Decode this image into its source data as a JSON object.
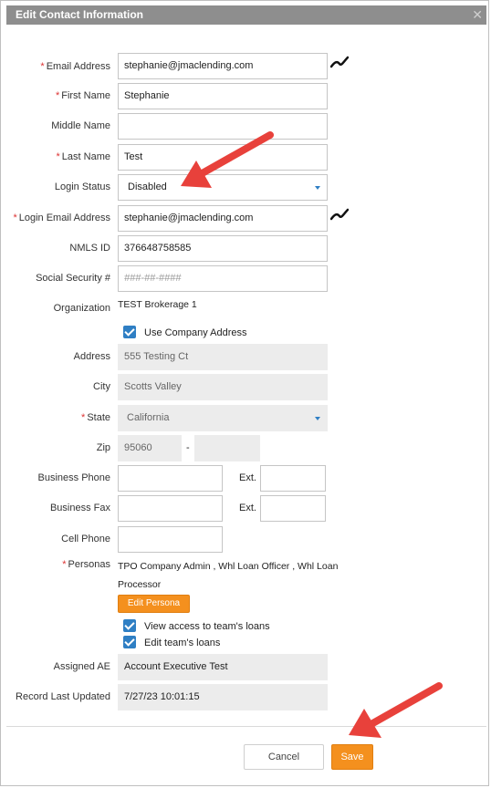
{
  "dialog": {
    "title": "Edit Contact Information",
    "close_glyph": "✕"
  },
  "fields": {
    "email": {
      "label": "Email Address",
      "value": "stephanie@jmaclending.com"
    },
    "first_name": {
      "label": "First Name",
      "value": "Stephanie"
    },
    "middle_name": {
      "label": "Middle Name",
      "value": ""
    },
    "last_name": {
      "label": "Last Name",
      "value": "Test"
    },
    "login_status": {
      "label": "Login Status",
      "value": "Disabled"
    },
    "login_email": {
      "label": "Login Email Address",
      "value": "stephanie@jmaclending.com"
    },
    "nmls_id": {
      "label": "NMLS ID",
      "value": "376648758585"
    },
    "ssn": {
      "label": "Social Security #",
      "placeholder": "###-##-####"
    },
    "organization": {
      "label": "Organization",
      "value": "TEST Brokerage 1"
    },
    "use_company_address": {
      "label": "Use Company Address",
      "checked": true
    },
    "address": {
      "label": "Address",
      "value": "555 Testing Ct"
    },
    "city": {
      "label": "City",
      "value": "Scotts Valley"
    },
    "state": {
      "label": "State",
      "value": "California"
    },
    "zip": {
      "label": "Zip",
      "value": "95060",
      "separator": "-",
      "ext_value": ""
    },
    "business_phone": {
      "label": "Business Phone",
      "value": "",
      "ext_label": "Ext.",
      "ext_value": ""
    },
    "business_fax": {
      "label": "Business Fax",
      "value": "",
      "ext_label": "Ext.",
      "ext_value": ""
    },
    "cell_phone": {
      "label": "Cell Phone",
      "value": ""
    },
    "personas": {
      "label": "Personas",
      "line1": "TPO Company Admin , Whl Loan Officer , Whl Loan",
      "line2": "Processor"
    },
    "view_access": {
      "label": "View access to team's loans",
      "checked": true
    },
    "edit_teams": {
      "label": "Edit team's loans",
      "checked": true
    },
    "assigned_ae": {
      "label": "Assigned AE",
      "value": "Account Executive Test"
    },
    "record_last_updated": {
      "label": "Record Last Updated",
      "value": "7/27/23 10:01:15"
    }
  },
  "required_mark": "*",
  "buttons": {
    "edit_persona": "Edit Persona",
    "cancel": "Cancel",
    "save": "Save"
  },
  "colors": {
    "accent": "#f4901e",
    "check": "#2f7fc4",
    "title_bar": "#8e8e8e",
    "annotation_arrow": "#e8413b"
  }
}
